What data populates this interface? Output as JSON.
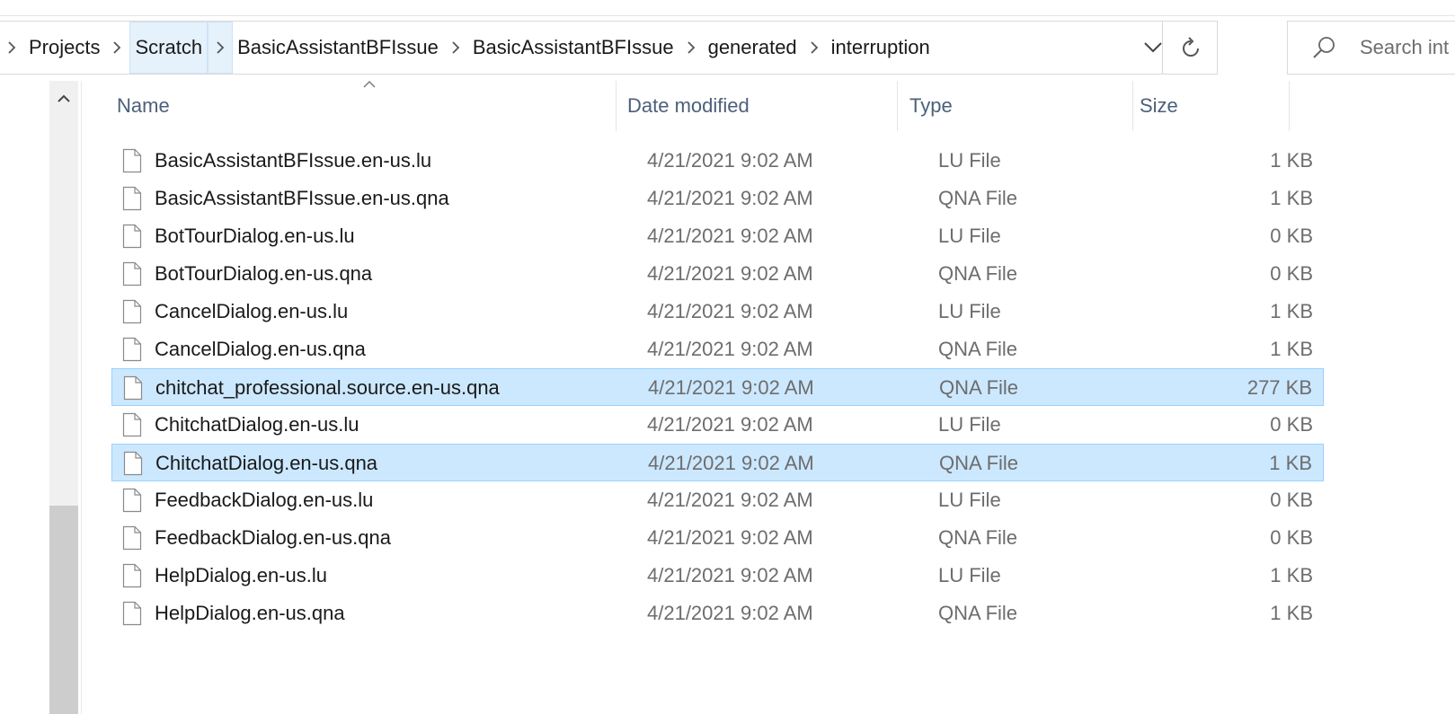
{
  "breadcrumb": {
    "items": [
      "Projects",
      "Scratch",
      "BasicAssistantBFIssue",
      "BasicAssistantBFIssue",
      "generated",
      "interruption"
    ]
  },
  "search": {
    "placeholder": "Search int"
  },
  "columns": {
    "name": "Name",
    "date": "Date modified",
    "type": "Type",
    "size": "Size"
  },
  "files": [
    {
      "name": "BasicAssistantBFIssue.en-us.lu",
      "date": "4/21/2021 9:02 AM",
      "type": "LU File",
      "size": "1 KB",
      "selected": false
    },
    {
      "name": "BasicAssistantBFIssue.en-us.qna",
      "date": "4/21/2021 9:02 AM",
      "type": "QNA File",
      "size": "1 KB",
      "selected": false
    },
    {
      "name": "BotTourDialog.en-us.lu",
      "date": "4/21/2021 9:02 AM",
      "type": "LU File",
      "size": "0 KB",
      "selected": false
    },
    {
      "name": "BotTourDialog.en-us.qna",
      "date": "4/21/2021 9:02 AM",
      "type": "QNA File",
      "size": "0 KB",
      "selected": false
    },
    {
      "name": "CancelDialog.en-us.lu",
      "date": "4/21/2021 9:02 AM",
      "type": "LU File",
      "size": "1 KB",
      "selected": false
    },
    {
      "name": "CancelDialog.en-us.qna",
      "date": "4/21/2021 9:02 AM",
      "type": "QNA File",
      "size": "1 KB",
      "selected": false
    },
    {
      "name": "chitchat_professional.source.en-us.qna",
      "date": "4/21/2021 9:02 AM",
      "type": "QNA File",
      "size": "277 KB",
      "selected": true
    },
    {
      "name": "ChitchatDialog.en-us.lu",
      "date": "4/21/2021 9:02 AM",
      "type": "LU File",
      "size": "0 KB",
      "selected": false
    },
    {
      "name": "ChitchatDialog.en-us.qna",
      "date": "4/21/2021 9:02 AM",
      "type": "QNA File",
      "size": "1 KB",
      "selected": true
    },
    {
      "name": "FeedbackDialog.en-us.lu",
      "date": "4/21/2021 9:02 AM",
      "type": "LU File",
      "size": "0 KB",
      "selected": false
    },
    {
      "name": "FeedbackDialog.en-us.qna",
      "date": "4/21/2021 9:02 AM",
      "type": "QNA File",
      "size": "0 KB",
      "selected": false
    },
    {
      "name": "HelpDialog.en-us.lu",
      "date": "4/21/2021 9:02 AM",
      "type": "LU File",
      "size": "1 KB",
      "selected": false
    },
    {
      "name": "HelpDialog.en-us.qna",
      "date": "4/21/2021 9:02 AM",
      "type": "QNA File",
      "size": "1 KB",
      "selected": false
    }
  ],
  "colors": {
    "selection_bg": "#cce8ff",
    "selection_border": "#99d1ff",
    "header_text": "#4c607a",
    "secondary_text": "#6d6d6d"
  }
}
